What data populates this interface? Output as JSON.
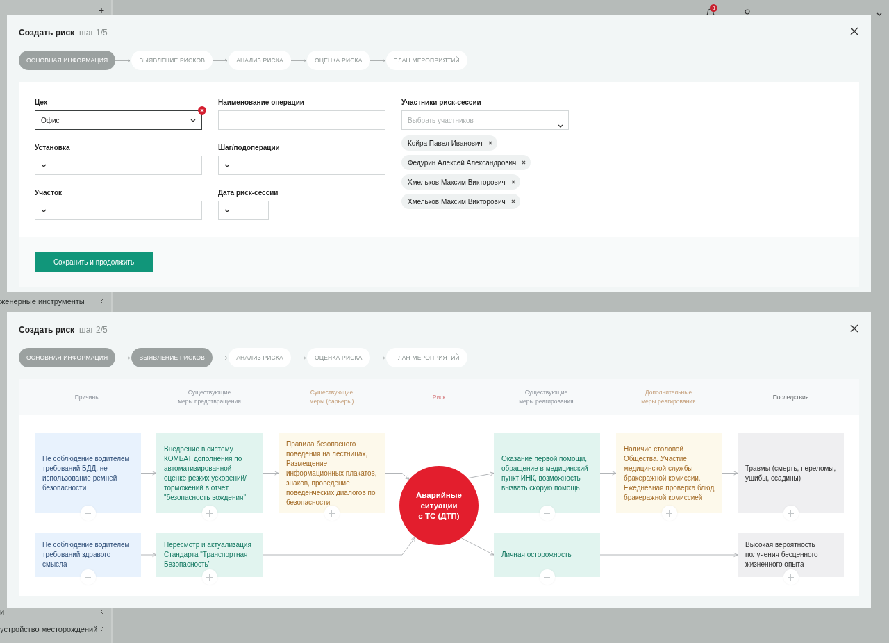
{
  "background": {
    "notification_count": "3",
    "sidebar": [
      {
        "label": "женерные инструменты",
        "kind": "item"
      },
      {
        "label": "и",
        "kind": "item"
      },
      {
        "label": "устройство месторождений",
        "kind": "item"
      }
    ]
  },
  "dialog_step1": {
    "title": "Создать риск",
    "step": "шаг 1/5",
    "steps": [
      {
        "label": "ОСНОВНАЯ ИНФОРМАЦИЯ",
        "completed": true
      },
      {
        "label": "ВЫЯВЛЕНИЕ РИСКОВ",
        "completed": false
      },
      {
        "label": "АНАЛИЗ РИСКА",
        "completed": false
      },
      {
        "label": "ОЦЕНКА РИСКА",
        "completed": false
      },
      {
        "label": "ПЛАН МЕРОПРИЯТИЙ",
        "completed": false
      }
    ],
    "columns": [
      {
        "fields": [
          {
            "label": "Цех",
            "kind": "select",
            "value": "Офис",
            "invalid": true
          },
          {
            "label": "Установка",
            "kind": "select",
            "invalid": false
          },
          {
            "label": "Участок",
            "kind": "select",
            "invalid": false
          }
        ]
      },
      {
        "fields": [
          {
            "label": "Наименование операции",
            "kind": "text",
            "invalid": false
          },
          {
            "label": "Шаг/подоперации",
            "kind": "select",
            "invalid": false
          },
          {
            "label": "Дата риск-сессии",
            "kind": "date",
            "invalid": false
          }
        ]
      },
      {
        "fields": [
          {
            "label": "Участники риск-сессии",
            "kind": "multiselect",
            "placeholder": "Выбрать участников",
            "invalid": false,
            "chips": [
              "Койра Павел Иванович",
              "Федурин Алексей Александрович",
              "Хмельков Максим Викторович",
              "Хмельков Максим Викторович"
            ]
          }
        ]
      }
    ],
    "save_button": "Сохранить и продолжить"
  },
  "dialog_step2": {
    "title": "Создать риск",
    "step": "шаг 2/5",
    "steps": [
      {
        "label": "ОСНОВНАЯ ИНФОРМАЦИЯ",
        "completed": true
      },
      {
        "label": "ВЫЯВЛЕНИЕ РИСКОВ",
        "completed": true
      },
      {
        "label": "АНАЛИЗ РИСКА",
        "completed": false
      },
      {
        "label": "ОЦЕНКА РИСКА",
        "completed": false
      },
      {
        "label": "ПЛАН МЕРОПРИЯТИЙ",
        "completed": false
      }
    ],
    "headers": [
      {
        "label": "Причины",
        "kind": "cause"
      },
      {
        "label": "Существующие\nмеры предотвращения",
        "kind": "prevention"
      },
      {
        "label": "Существующие\nмеры (барьеры)",
        "kind": "barrier"
      },
      {
        "label": "Риск",
        "kind": "risk"
      },
      {
        "label": "Существующие\nмеры реагирования",
        "kind": "response"
      },
      {
        "label": "Дополнительные\nмеры реагирования",
        "kind": "additional"
      },
      {
        "label": "Последствия",
        "kind": "consequence"
      }
    ],
    "risk": "Аварийные\nситуации\nс ТС (ДТП)",
    "rows": [
      {
        "nodes": [
          {
            "kind": "cause",
            "text": "Не соблюдение водителем требований БДД, не использование ремней безопасности"
          },
          {
            "kind": "prevention",
            "text": "Внедрение в систему КОМБАТ дополнения по автоматизированной оценке резких ускорений/торможений в отчёт \"безопасность вождения\""
          },
          {
            "kind": "barrier",
            "text": "Правила безопасного поведения на лестницах, Размещение информационных плакатов, знаков, проведение поведенческих диалогов по безопасности"
          },
          {
            "kind": "response",
            "text": "Оказание первой помощи, обращение в медицинский пункт ИНК, возможность вызвать скорую помощь"
          },
          {
            "kind": "additional",
            "text": "Наличие столовой Общества. Участие медицинской службы бракеражной комиссии. Ежедневная проверка блюд бракеражной комиссией"
          },
          {
            "kind": "consequence",
            "text": "Травмы (смерть, переломы, ушибы, ссадины)"
          }
        ]
      },
      {
        "nodes": [
          {
            "kind": "cause",
            "text": "Не соблюдение водителем требований здравого смысла"
          },
          {
            "kind": "prevention",
            "text": "Пересмотр и актуализация Стандарта \"Транспортная Безопасность\""
          },
          {
            "kind": "response",
            "text": "Личная осторожность"
          },
          {
            "kind": "consequence",
            "text": "Высокая вероятность получения бесценного жизненного опыта"
          }
        ]
      }
    ]
  }
}
